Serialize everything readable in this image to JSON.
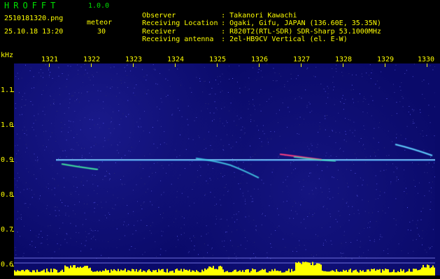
{
  "header": {
    "logo": "HROFFT",
    "version": "1.0.0",
    "filename": "2510181320.png",
    "datetime": "25.10.18 13:20",
    "mode_label": "meteor",
    "count": "30",
    "info": [
      {
        "label": "Observer",
        "value": ": Takanori Kawachi"
      },
      {
        "label": "Receiving Location",
        "value": ": Ogaki, Gifu, JAPAN (136.60E, 35.35N)"
      },
      {
        "label": "Receiver",
        "value": ": R820T2(RTL-SDR) SDR-Sharp 53.1000MHz"
      },
      {
        "label": "Receiving antenna",
        "value": ": 2el-HB9CV Vertical (el. E-W)"
      }
    ]
  },
  "axes": {
    "y_unit": "kHz",
    "x_ticks": [
      "1321",
      "1322",
      "1323",
      "1324",
      "1325",
      "1326",
      "1327",
      "1328",
      "1329",
      "1330"
    ],
    "y_ticks": [
      "1.1",
      "1.0",
      "0.9",
      "0.8",
      "0.7",
      "0.6"
    ]
  },
  "colors": {
    "text": "#ffff00",
    "logo": "#00e000",
    "background": "#0a0a6a",
    "carrier": "#60c0ff",
    "level": "#ffff00"
  }
}
